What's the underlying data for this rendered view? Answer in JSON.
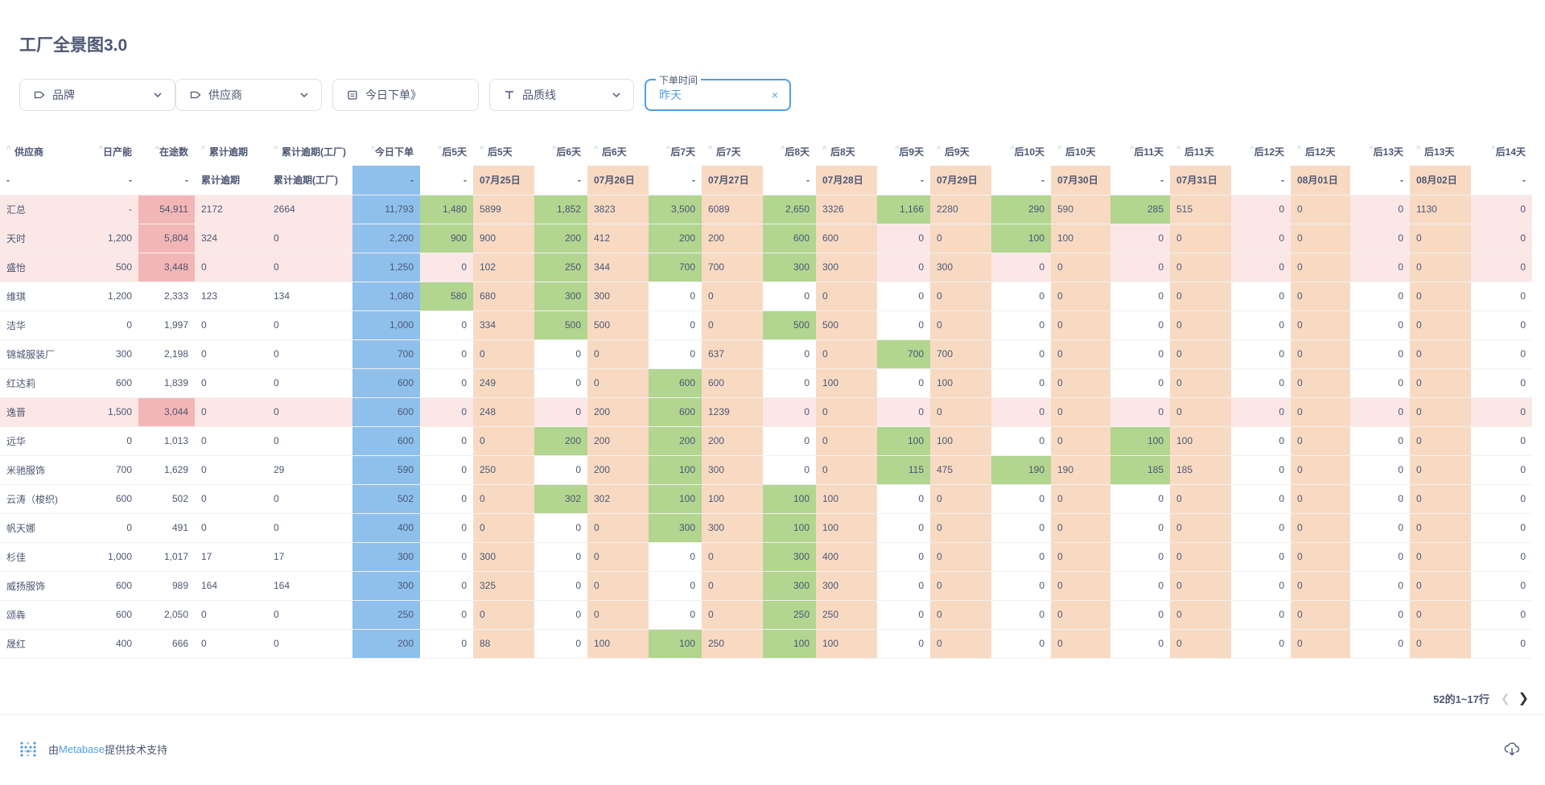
{
  "page": {
    "title": "工厂全景图3.0"
  },
  "filters": {
    "brand": "品牌",
    "supplier": "供应商",
    "today_order": "今日下单》",
    "quality_line": "品质线",
    "order_time": {
      "legend": "下单时间",
      "value": "昨天",
      "clear": "×"
    }
  },
  "table": {
    "columns": [
      "供应商",
      "日产能",
      "在途数",
      "累计逾期",
      "累计逾期(工厂)",
      "今日下单",
      "后5天",
      "后5天",
      "后6天",
      "后6天",
      "后7天",
      "后7天",
      "后8天",
      "后8天",
      "后9天",
      "后9天",
      "后10天",
      "后10天",
      "后11天",
      "后11天",
      "后12天",
      "后12天",
      "后13天",
      "后13天",
      "后14天"
    ],
    "subheader": [
      "-",
      "-",
      "-",
      "累计逾期",
      "累计逾期(工厂)",
      "-",
      "-",
      "07月25日",
      "-",
      "07月26日",
      "-",
      "07月27日",
      "-",
      "07月28日",
      "-",
      "07月29日",
      "-",
      "07月30日",
      "-",
      "07月31日",
      "-",
      "08月01日",
      "-",
      "08月02日",
      "-"
    ],
    "rows": [
      [
        "汇总",
        "-",
        "54,911",
        "2172",
        "2664",
        "11,793",
        "1,480",
        "5899",
        "1,852",
        "3823",
        "3,500",
        "6089",
        "2,650",
        "3326",
        "1,166",
        "2280",
        "290",
        "590",
        "285",
        "515",
        "0",
        "0",
        "0",
        "1130",
        "0"
      ],
      [
        "天时",
        "1,200",
        "5,804",
        "324",
        "0",
        "2,200",
        "900",
        "900",
        "200",
        "412",
        "200",
        "200",
        "600",
        "600",
        "0",
        "0",
        "100",
        "100",
        "0",
        "0",
        "0",
        "0",
        "0",
        "0",
        "0"
      ],
      [
        "盛怡",
        "500",
        "3,448",
        "0",
        "0",
        "1,250",
        "0",
        "102",
        "250",
        "344",
        "700",
        "700",
        "300",
        "300",
        "0",
        "300",
        "0",
        "0",
        "0",
        "0",
        "0",
        "0",
        "0",
        "0",
        "0"
      ],
      [
        "维琪",
        "1,200",
        "2,333",
        "123",
        "134",
        "1,080",
        "580",
        "680",
        "300",
        "300",
        "0",
        "0",
        "0",
        "0",
        "0",
        "0",
        "0",
        "0",
        "0",
        "0",
        "0",
        "0",
        "0",
        "0",
        "0"
      ],
      [
        "洁华",
        "0",
        "1,997",
        "0",
        "0",
        "1,000",
        "0",
        "334",
        "500",
        "500",
        "0",
        "0",
        "500",
        "500",
        "0",
        "0",
        "0",
        "0",
        "0",
        "0",
        "0",
        "0",
        "0",
        "0",
        "0"
      ],
      [
        "锦城服装厂",
        "300",
        "2,198",
        "0",
        "0",
        "700",
        "0",
        "0",
        "0",
        "0",
        "0",
        "637",
        "0",
        "0",
        "700",
        "700",
        "0",
        "0",
        "0",
        "0",
        "0",
        "0",
        "0",
        "0",
        "0"
      ],
      [
        "红达莉",
        "600",
        "1,839",
        "0",
        "0",
        "600",
        "0",
        "249",
        "0",
        "0",
        "600",
        "600",
        "0",
        "100",
        "0",
        "100",
        "0",
        "0",
        "0",
        "0",
        "0",
        "0",
        "0",
        "0",
        "0"
      ],
      [
        "逸晋",
        "1,500",
        "3,044",
        "0",
        "0",
        "600",
        "0",
        "248",
        "0",
        "200",
        "600",
        "1239",
        "0",
        "0",
        "0",
        "0",
        "0",
        "0",
        "0",
        "0",
        "0",
        "0",
        "0",
        "0",
        "0"
      ],
      [
        "远华",
        "0",
        "1,013",
        "0",
        "0",
        "600",
        "0",
        "0",
        "200",
        "200",
        "200",
        "200",
        "0",
        "0",
        "100",
        "100",
        "0",
        "0",
        "100",
        "100",
        "0",
        "0",
        "0",
        "0",
        "0"
      ],
      [
        "米驰服饰",
        "700",
        "1,629",
        "0",
        "29",
        "590",
        "0",
        "250",
        "0",
        "200",
        "100",
        "300",
        "0",
        "0",
        "115",
        "475",
        "190",
        "190",
        "185",
        "185",
        "0",
        "0",
        "0",
        "0",
        "0"
      ],
      [
        "云涛（梭织)",
        "600",
        "502",
        "0",
        "0",
        "502",
        "0",
        "0",
        "302",
        "302",
        "100",
        "100",
        "100",
        "100",
        "0",
        "0",
        "0",
        "0",
        "0",
        "0",
        "0",
        "0",
        "0",
        "0",
        "0"
      ],
      [
        "帆天娜",
        "0",
        "491",
        "0",
        "0",
        "400",
        "0",
        "0",
        "0",
        "0",
        "300",
        "300",
        "100",
        "100",
        "0",
        "0",
        "0",
        "0",
        "0",
        "0",
        "0",
        "0",
        "0",
        "0",
        "0"
      ],
      [
        "杉佳",
        "1,000",
        "1,017",
        "17",
        "17",
        "300",
        "0",
        "300",
        "0",
        "0",
        "0",
        "0",
        "300",
        "400",
        "0",
        "0",
        "0",
        "0",
        "0",
        "0",
        "0",
        "0",
        "0",
        "0",
        "0"
      ],
      [
        "威扬服饰",
        "600",
        "989",
        "164",
        "164",
        "300",
        "0",
        "325",
        "0",
        "0",
        "0",
        "0",
        "300",
        "300",
        "0",
        "0",
        "0",
        "0",
        "0",
        "0",
        "0",
        "0",
        "0",
        "0",
        "0"
      ],
      [
        "颂犇",
        "600",
        "2,050",
        "0",
        "0",
        "250",
        "0",
        "0",
        "0",
        "0",
        "0",
        "0",
        "250",
        "250",
        "0",
        "0",
        "0",
        "0",
        "0",
        "0",
        "0",
        "0",
        "0",
        "0",
        "0"
      ],
      [
        "晟红",
        "400",
        "666",
        "0",
        "0",
        "200",
        "0",
        "88",
        "0",
        "100",
        "100",
        "250",
        "100",
        "100",
        "0",
        "0",
        "0",
        "0",
        "0",
        "0",
        "0",
        "0",
        "0",
        "0",
        "0"
      ]
    ],
    "row_highlight": [
      true,
      true,
      true,
      false,
      false,
      false,
      false,
      true,
      false,
      false,
      false,
      false,
      false,
      false,
      false,
      false
    ],
    "colors": {
      "pink": "#fce7e7",
      "pink_dark": "#f3b6b6",
      "blue": "#8fc0ec",
      "green": "#b2d590",
      "peach": "#f8dac3"
    }
  },
  "pagination": {
    "label": "52的1~17行"
  },
  "footer": {
    "prefix": "由",
    "brand": "Metabase",
    "suffix": "提供技术支持"
  }
}
